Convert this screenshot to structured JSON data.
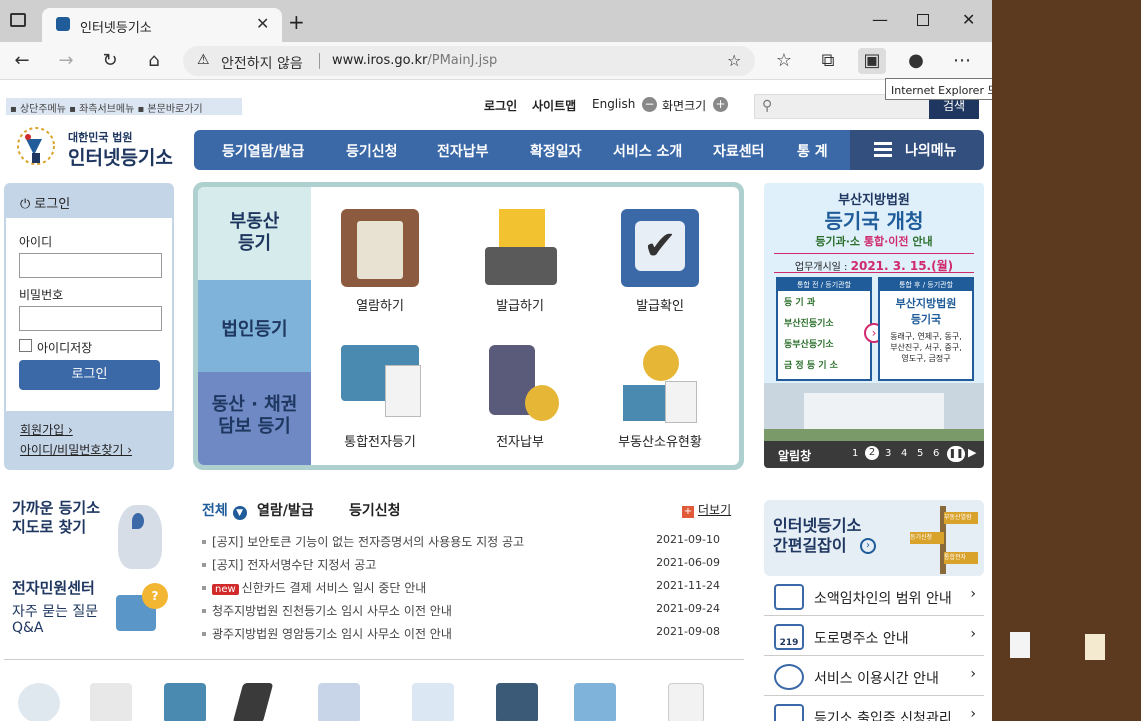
{
  "browser": {
    "tab_title": "인터넷등기소",
    "address_security": "안전하지 않음",
    "url_host": "www.iros.go.kr",
    "url_path": "/PMainJ.jsp",
    "tooltip": "Internet Explorer 모드에서 탭 다시 로드"
  },
  "header": {
    "skip_links": "▪ 상단주메뉴 ▪ 좌측서브메뉴 ▪ 본문바로가기",
    "login": "로그인",
    "sitemap": "사이트맵",
    "english": "English",
    "font_size": "화면크기",
    "search_button": "검색",
    "logo_sub": "대한민국 법원",
    "logo_main": "인터넷등기소"
  },
  "gnb": {
    "items": [
      "등기열람/발급",
      "등기신청",
      "전자납부",
      "확정일자",
      "서비스 소개",
      "자료센터",
      "통 계"
    ],
    "mymenu": "나의메뉴"
  },
  "login_box": {
    "title": "로그인",
    "id_label": "아이디",
    "pw_label": "비밀번호",
    "save_id": "아이디저장",
    "button": "로그인",
    "join": "회원가입",
    "find": "아이디/비밀번호찾기"
  },
  "services": {
    "categories": [
      "부동산\n등기",
      "법인등기",
      "동산 · 채권\n담보 등기"
    ],
    "items": [
      "열람하기",
      "발급하기",
      "발급확인",
      "통합전자등기",
      "전자납부",
      "부동산소유현황"
    ]
  },
  "banner": {
    "court": "부산지방법원",
    "headline": "등기국 개청",
    "sub_a": "등기과·소",
    "sub_b": "통합·이전",
    "sub_c": "안내",
    "start_label": "업무개시일 :",
    "start_date": "2021. 3. 15.(월)",
    "left_head": "통합 전 / 등기관할",
    "left_items": [
      "등 기 과",
      "부산진등기소",
      "동부산등기소",
      "금 정 등 기 소"
    ],
    "right_head": "통합 후 / 등기관할",
    "right_title": "부산지방법원\n등기국",
    "right_desc": "동래구, 연제구, 동구,\n부산진구, 서구, 중구,\n영도구, 금정구",
    "footer_label": "알림창",
    "pages": [
      "1",
      "2",
      "3",
      "4",
      "5",
      "6"
    ]
  },
  "left_lower": {
    "near": "가까운 등기소\n지도로 찾기",
    "center": "전자민원센터",
    "faq": "자주 묻는 질문\nQ&A"
  },
  "news": {
    "tabs": [
      "전체",
      "열람/발급",
      "등기신청"
    ],
    "more": "더보기",
    "rows": [
      {
        "title": "[공지] 보안토큰 기능이 없는 전자증명서의 사용용도 지정 공고",
        "date": "2021-09-10",
        "new": false
      },
      {
        "title": "[공지] 전자서명수단 지정서 공고",
        "date": "2021-06-09",
        "new": false
      },
      {
        "title": "신한카드 결제 서비스 일시 중단 안내",
        "date": "2021-11-24",
        "new": true
      },
      {
        "title": "청주지방법원 진천등기소 임시 사무소 이전 안내",
        "date": "2021-09-24",
        "new": false
      },
      {
        "title": "광주지방법원 영암등기소 임시 사무소 이전 안내",
        "date": "2021-09-08",
        "new": false
      }
    ],
    "new_label": "new"
  },
  "right_lower": {
    "guide": "인터넷등기소\n간편길잡이",
    "sign_labels": [
      "부동산열람",
      "등기신청",
      "통합전자"
    ],
    "quick": [
      "소액임차인의 범위 안내",
      "도로명주소 안내",
      "서비스 이용시간 안내",
      "등기소 출입증 신청관리"
    ],
    "road_number": "219"
  },
  "colors": {
    "brand": "#3b69a8",
    "brand_dark": "#1f3760",
    "panel": "#aed0cf"
  }
}
